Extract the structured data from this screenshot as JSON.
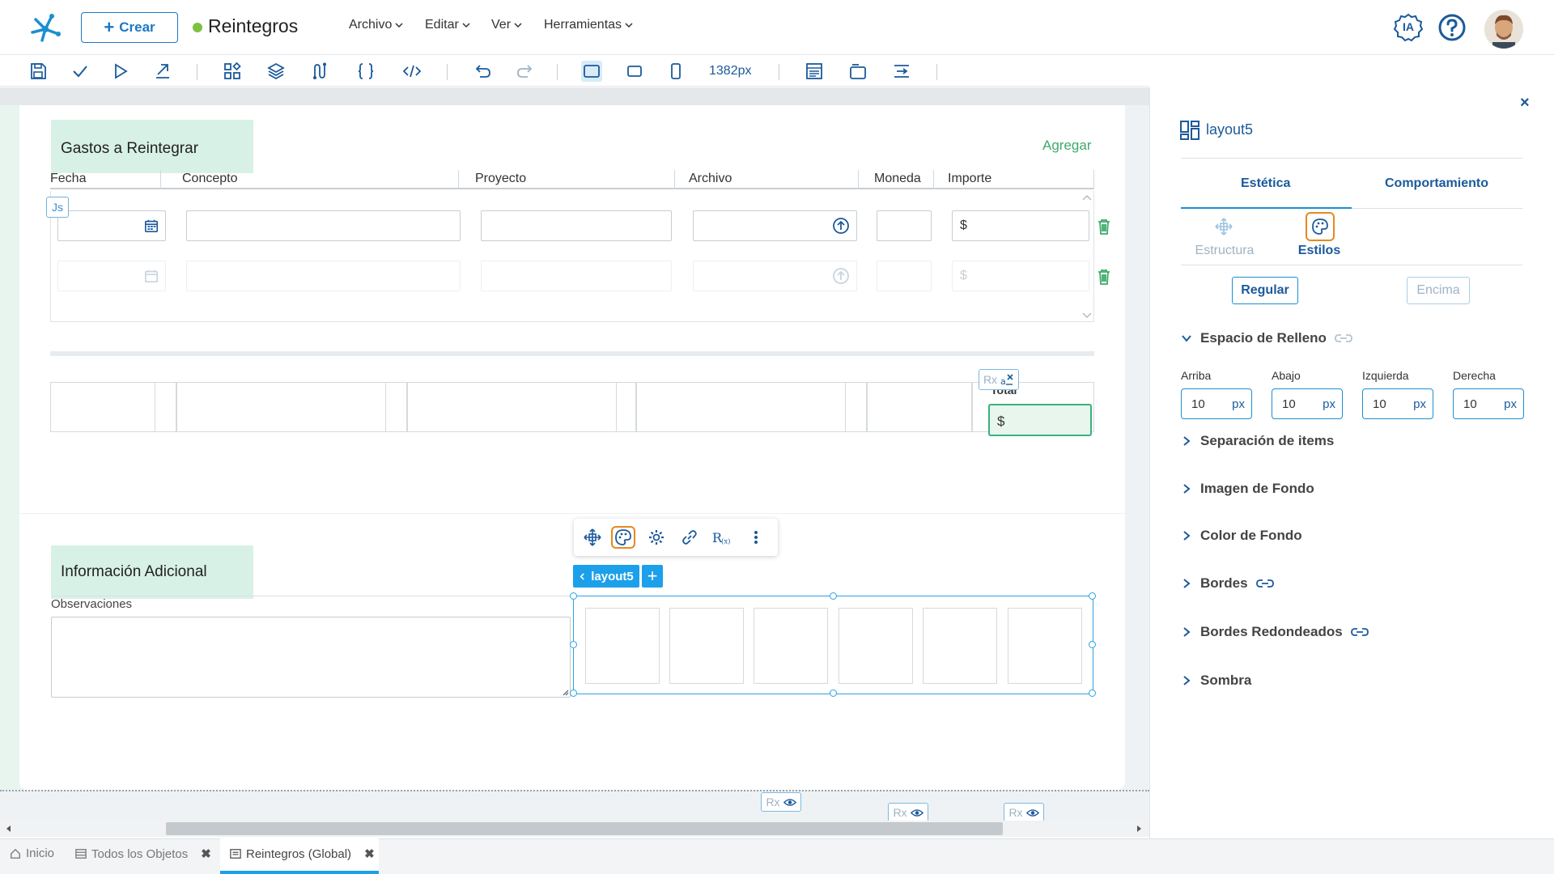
{
  "topbar": {
    "crear_label": "Crear",
    "app_title": "Reintegros",
    "menus": [
      "Archivo",
      "Editar",
      "Ver",
      "Herramientas"
    ],
    "ia_label": "IA",
    "status_color": "#7cc142"
  },
  "toolbar": {
    "width_label": "1382px",
    "icons": [
      "save-icon",
      "check-icon",
      "play-icon",
      "publish-icon",
      "widgets-icon",
      "layers-icon",
      "flow-icon",
      "braces-icon",
      "code-icon",
      "undo-icon",
      "redo-icon",
      "desktop-icon",
      "tablet-icon",
      "mobile-icon",
      "window-icon",
      "frame-icon",
      "align-icon"
    ]
  },
  "form": {
    "section1_title": "Gastos a Reintegrar",
    "add_label": "Agregar",
    "columns": [
      "Fecha",
      "Concepto",
      "Proyecto",
      "Archivo",
      "Moneda",
      "Importe"
    ],
    "currency_symbol": "$",
    "js_badge": "Js",
    "total_label": "Total",
    "rx_label": "Rx",
    "section2_title": "Información Adicional",
    "observaciones_label": "Observaciones"
  },
  "layout_tag": {
    "label": "layout5",
    "add_symbol": "+"
  },
  "bottom_tabs": [
    {
      "label": "Inicio",
      "closable": false
    },
    {
      "label": "Todos los Objetos",
      "closable": true
    },
    {
      "label": "Reintegros (Global)",
      "closable": true,
      "active": true
    }
  ],
  "panel": {
    "title": "layout5",
    "tabs": [
      "Estética",
      "Comportamiento"
    ],
    "subtabs": [
      "Estructura",
      "Estilos"
    ],
    "state_buttons": [
      "Regular",
      "Encima"
    ],
    "accordions": [
      "Espacio de Relleno",
      "Separación de items",
      "Imagen de Fondo",
      "Color de Fondo",
      "Bordes",
      "Bordes Redondeados",
      "Sombra"
    ],
    "padding": [
      {
        "label": "Arriba",
        "value": "10",
        "unit": "px"
      },
      {
        "label": "Abajo",
        "value": "10",
        "unit": "px"
      },
      {
        "label": "Izquierda",
        "value": "10",
        "unit": "px"
      },
      {
        "label": "Derecha",
        "value": "10",
        "unit": "px"
      }
    ]
  },
  "colors": {
    "brand_blue": "#1b5a9b",
    "accent_blue": "#1ca0ea",
    "green": "#3ea96a",
    "selection_orange": "#e58a1f"
  }
}
